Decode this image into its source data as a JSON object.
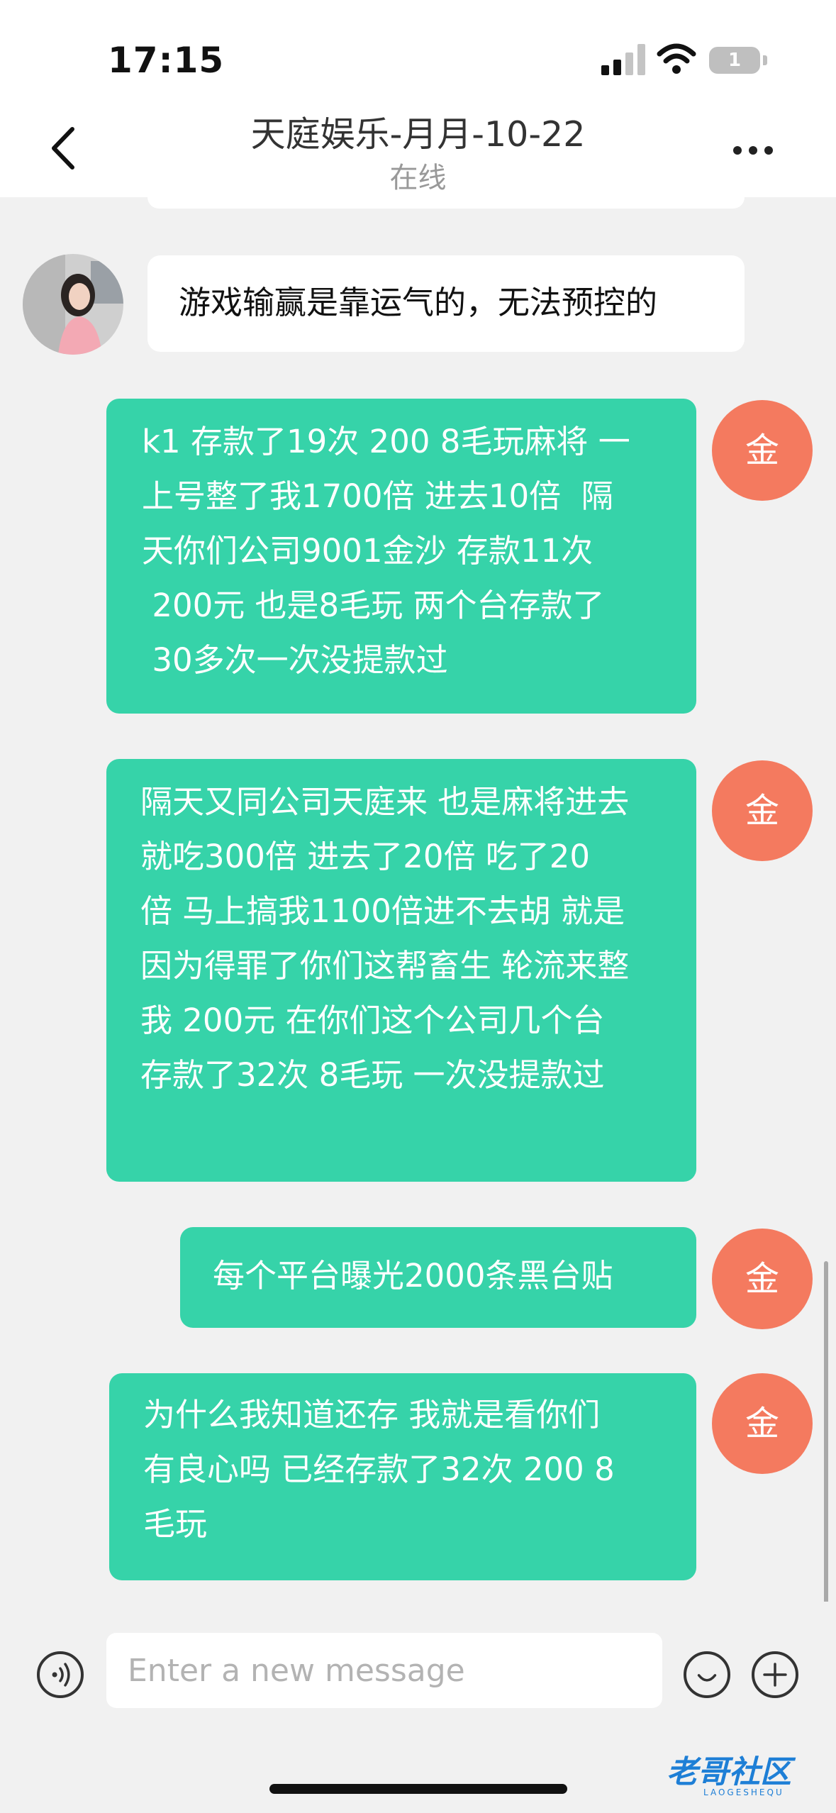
{
  "status_bar": {
    "time": "17:15",
    "battery": "1"
  },
  "header": {
    "title": "天庭娱乐-月月-10-22",
    "status": "在线"
  },
  "messages": [
    {
      "side": "in",
      "text": "游戏输赢是靠运气的，无法预控的"
    },
    {
      "side": "out",
      "avatar": "金",
      "text": "k1 存款了19次 200 8毛玩麻将 一\n上号整了我1700倍 进去10倍  隔\n天你们公司9001金沙 存款11次\n 200元 也是8毛玩 两个台存款了\n 30多次一次没提款过"
    },
    {
      "side": "out",
      "avatar": "金",
      "text": "隔天又同公司天庭来 也是麻将进去\n就吃300倍 进去了20倍 吃了20\n倍 马上搞我1100倍进不去胡 就是\n因为得罪了你们这帮畜生 轮流来整\n我 200元 在你们这个公司几个台\n存款了32次 8毛玩 一次没提款过"
    },
    {
      "side": "out",
      "avatar": "金",
      "text": "每个平台曝光2000条黑台贴"
    },
    {
      "side": "out",
      "avatar": "金",
      "text": "为什么我知道还存 我就是看你们\n有良心吗 已经存款了32次 200 8\n毛玩"
    }
  ],
  "input": {
    "placeholder": "Enter a new message"
  },
  "watermark": {
    "text": "老哥社区",
    "sub": "LAOGESHEQU"
  },
  "colors": {
    "outgoing_bubble": "#36d3a9",
    "avatar_badge": "#f47a5f",
    "incoming_bubble": "#ffffff",
    "background": "#f1f1f1"
  }
}
